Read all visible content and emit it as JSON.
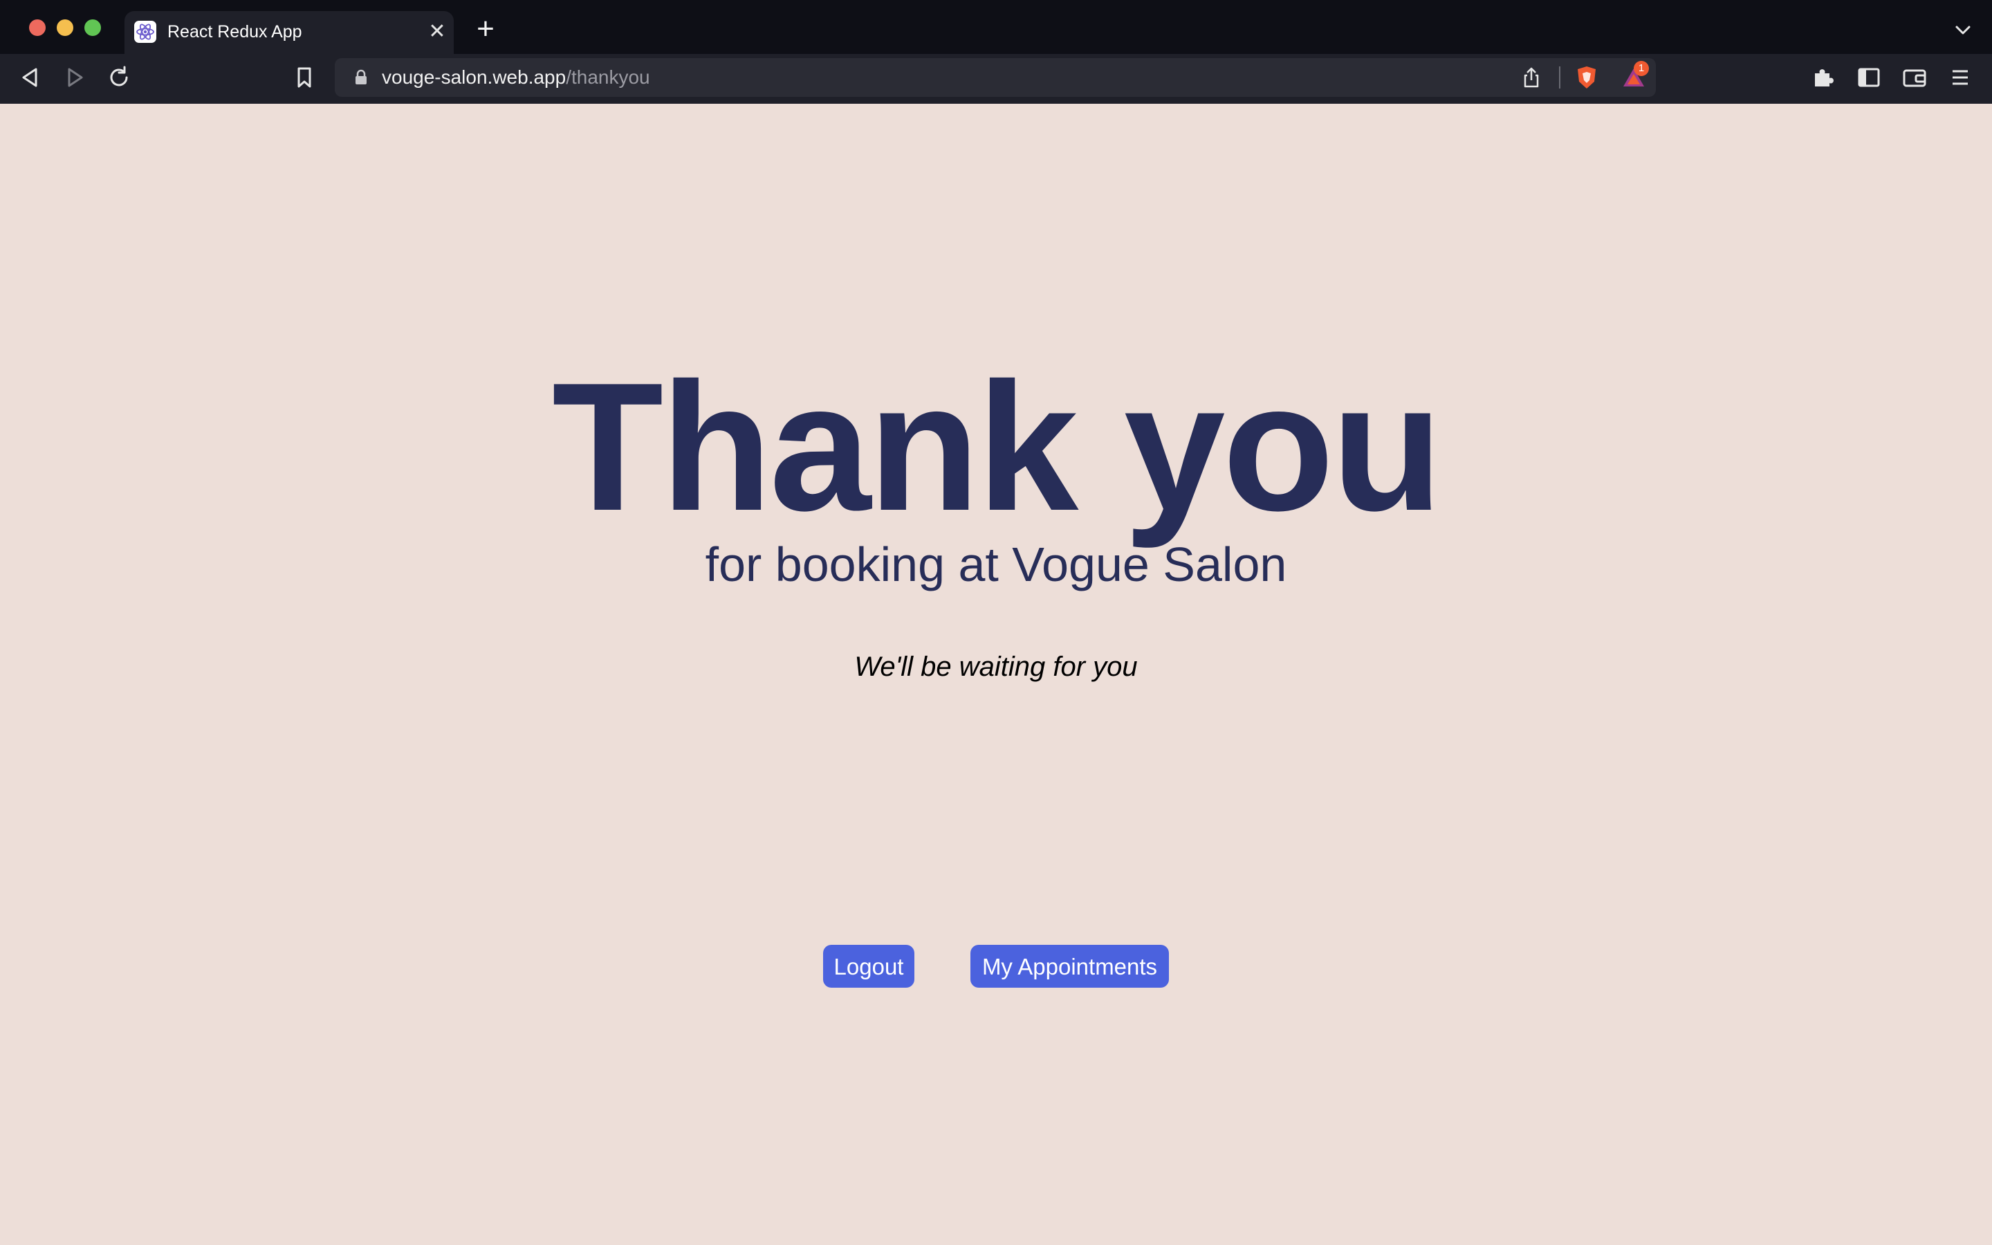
{
  "browser": {
    "tab": {
      "title": "React Redux App"
    },
    "address": {
      "host": "vouge-salon.web.app",
      "path": "/thankyou"
    },
    "rewards_badge": "1"
  },
  "page": {
    "heading": "Thank you",
    "subheading": "for booking at Vogue Salon",
    "tagline": "We'll be waiting for you",
    "buttons": {
      "logout": "Logout",
      "appointments": "My Appointments"
    }
  },
  "colors": {
    "page_background": "#edded8",
    "heading": "#272d58",
    "button": "#4b62de"
  }
}
